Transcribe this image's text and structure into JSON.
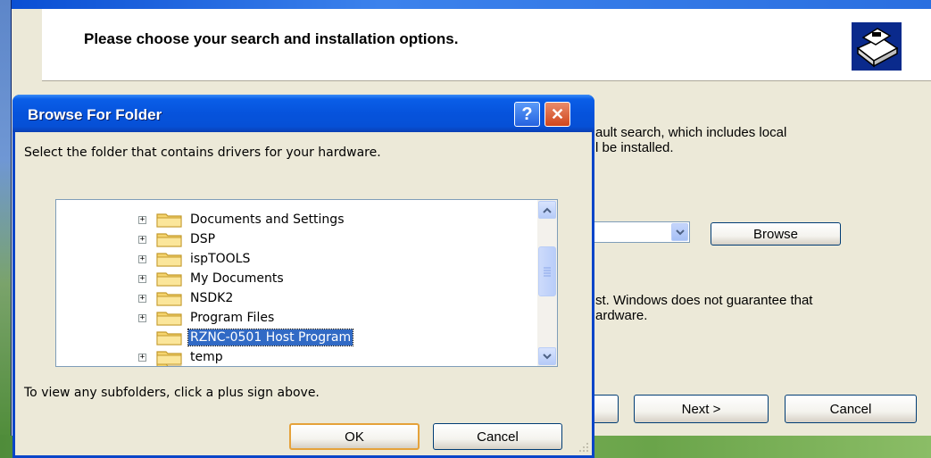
{
  "wizard": {
    "header_title": "Please choose your search and installation options.",
    "text_line1": "ault search, which includes local",
    "text_line2": "l be installed.",
    "text_line3": "st.  Windows does not guarantee that",
    "text_line4": "ardware.",
    "browse_label": "Browse",
    "next_label": "Next >",
    "cancel_label": "Cancel",
    "header_icon": "hardware-wizard-icon"
  },
  "dialog": {
    "title": "Browse For Folder",
    "help_label": "?",
    "close_label": "✕",
    "instruction": "Select the folder that contains drivers for your hardware.",
    "hint": "To view any subfolders, click a plus sign above.",
    "ok_label": "OK",
    "cancel_label": "Cancel",
    "tree": [
      {
        "label": "Documents and Settings",
        "expandable": true,
        "selected": false
      },
      {
        "label": "DSP",
        "expandable": true,
        "selected": false
      },
      {
        "label": "ispTOOLS",
        "expandable": true,
        "selected": false
      },
      {
        "label": "My Documents",
        "expandable": true,
        "selected": false
      },
      {
        "label": "NSDK2",
        "expandable": true,
        "selected": false
      },
      {
        "label": "Program Files",
        "expandable": true,
        "selected": false
      },
      {
        "label": "RZNC-0501 Host Program",
        "expandable": false,
        "selected": true
      },
      {
        "label": "temp",
        "expandable": true,
        "selected": false
      }
    ]
  },
  "colors": {
    "titlebar": "#0653dc",
    "selection": "#316ac5",
    "folder": "#f5d46e"
  }
}
